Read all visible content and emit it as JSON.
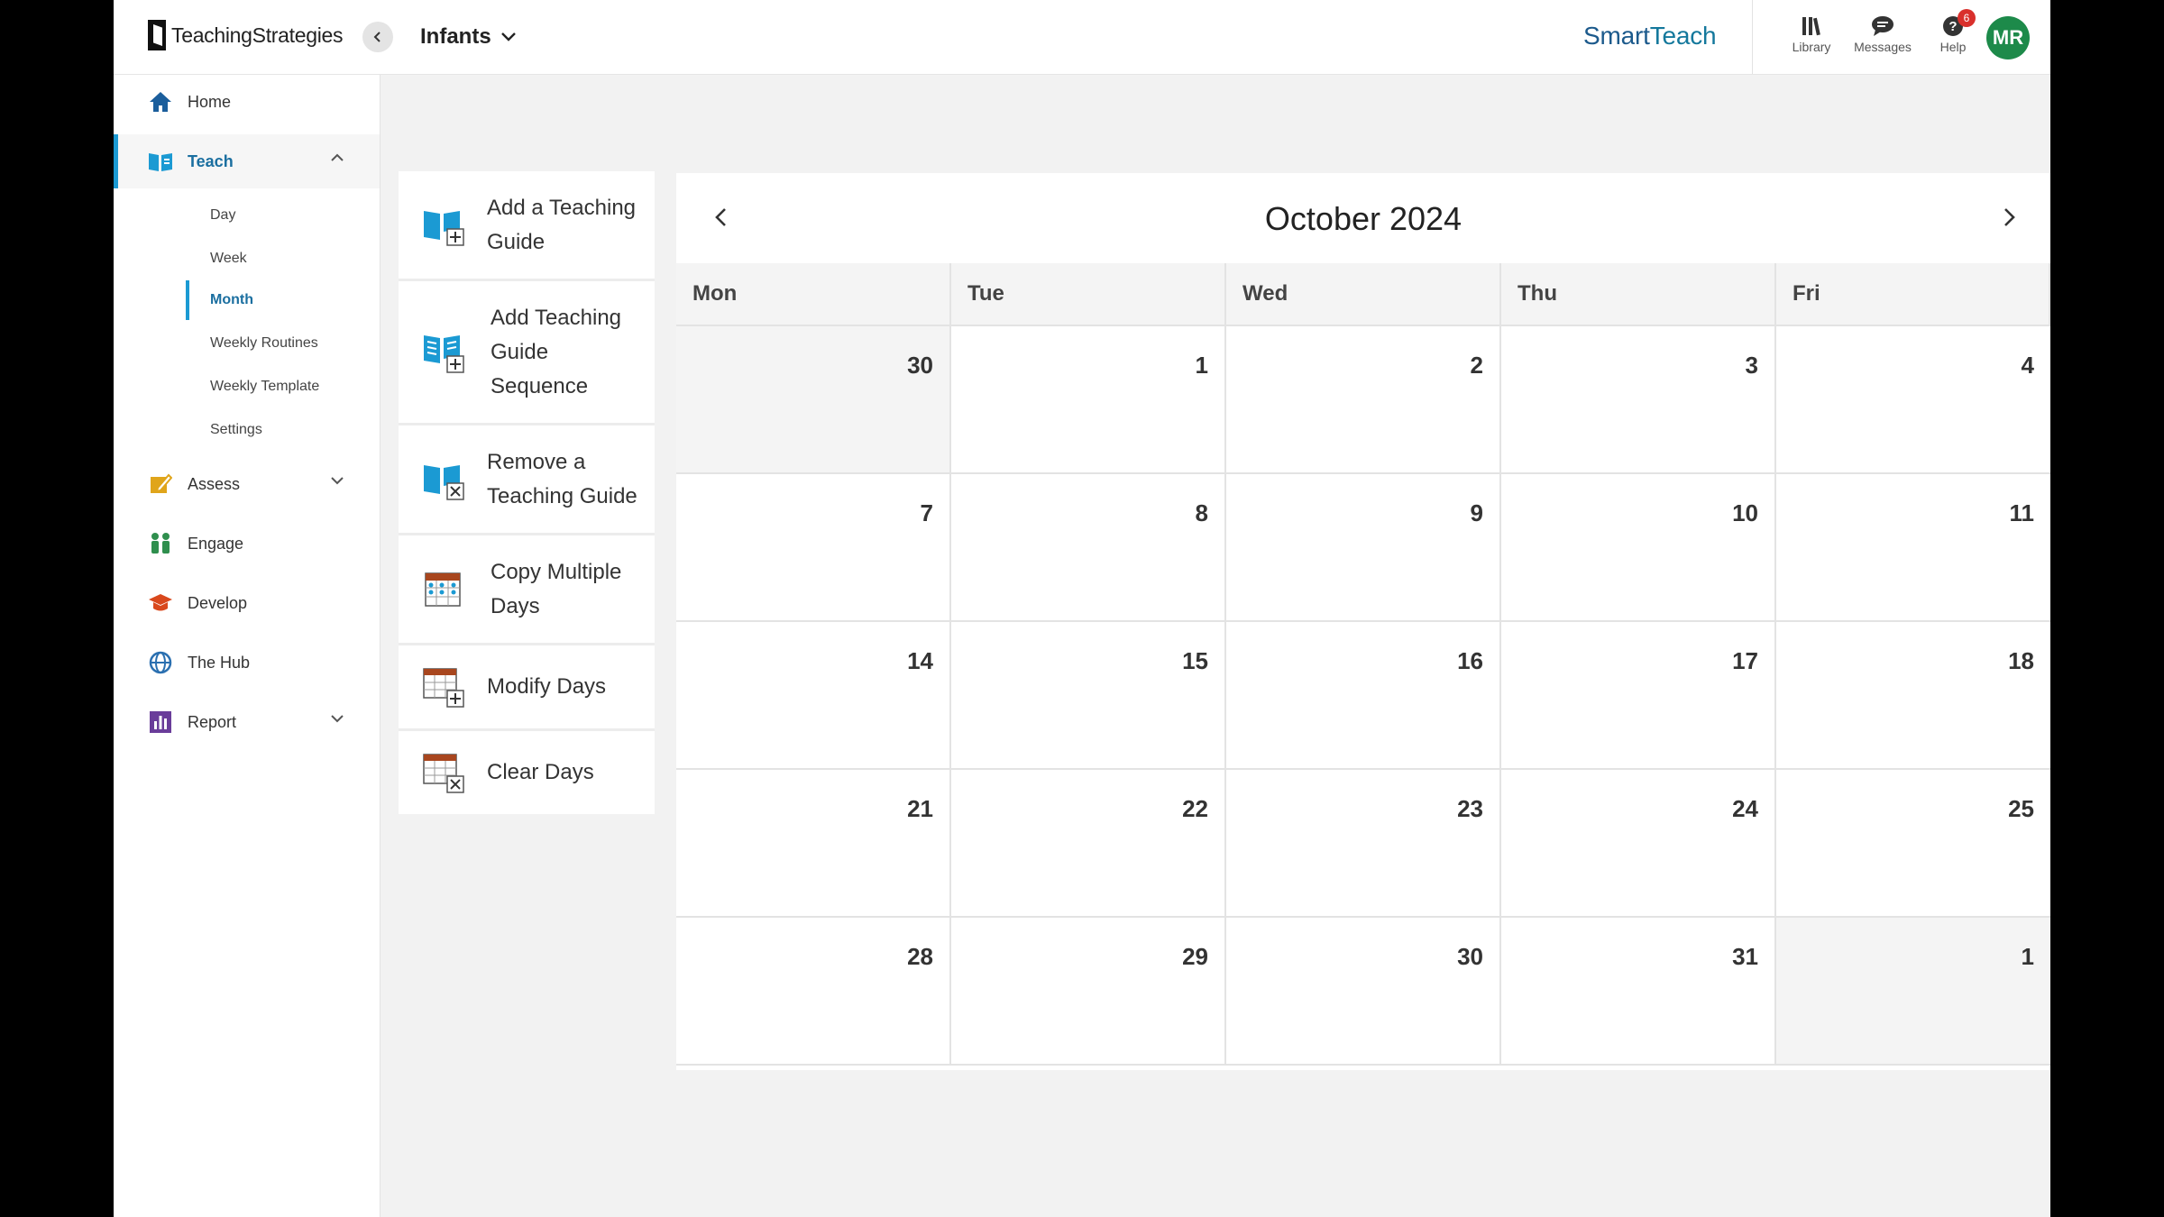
{
  "header": {
    "logo_text": "TeachingStrategies",
    "class_name": "Infants",
    "brand": "SmartTeach",
    "brand_parts": [
      "Smart",
      "Teach"
    ],
    "icons": [
      {
        "label": "Library",
        "icon": "library-icon"
      },
      {
        "label": "Messages",
        "icon": "messages-icon"
      },
      {
        "label": "Help",
        "icon": "help-icon",
        "badge": "6"
      }
    ],
    "avatar_initials": "MR"
  },
  "sidebar": {
    "items": [
      {
        "label": "Home",
        "icon": "home-icon",
        "color": "#1b5e9c"
      },
      {
        "label": "Teach",
        "icon": "book-icon",
        "color": "#1b9ad3",
        "expanded": true
      },
      {
        "label": "Assess",
        "icon": "assess-icon",
        "color": "#e0a51b"
      },
      {
        "label": "Engage",
        "icon": "engage-icon",
        "color": "#2f8f4e"
      },
      {
        "label": "Develop",
        "icon": "graduation-cap-icon",
        "color": "#d9481c"
      },
      {
        "label": "The Hub",
        "icon": "globe-icon",
        "color": "#2a6fb0"
      },
      {
        "label": "Report",
        "icon": "report-icon",
        "color": "#6a3d9a"
      }
    ],
    "teach_sub_items": [
      "Day",
      "Week",
      "Month",
      "Weekly Routines",
      "Weekly Template",
      "Settings"
    ],
    "active_sub_item": "Month"
  },
  "actions": [
    {
      "label": "Add a Teaching Guide",
      "lines": [
        "Add a Teaching",
        "Guide"
      ],
      "icon": "add-guide-icon"
    },
    {
      "label": "Add Teaching Guide Sequence",
      "lines": [
        "Add Teaching",
        "Guide",
        "Sequence"
      ],
      "icon": "add-sequence-icon"
    },
    {
      "label": "Remove a Teaching Guide",
      "lines": [
        "Remove a",
        "Teaching Guide"
      ],
      "icon": "remove-guide-icon"
    },
    {
      "label": "Copy Multiple Days",
      "lines": [
        "Copy Multiple",
        "Days"
      ],
      "icon": "copy-days-icon"
    },
    {
      "label": "Modify Days",
      "lines": [
        "Modify Days"
      ],
      "icon": "modify-days-icon"
    },
    {
      "label": "Clear Days",
      "lines": [
        "Clear Days"
      ],
      "icon": "clear-days-icon"
    }
  ],
  "calendar": {
    "title": "October 2024",
    "weekdays": [
      "Mon",
      "Tue",
      "Wed",
      "Thu",
      "Fri"
    ],
    "weeks": [
      [
        "30",
        "1",
        "2",
        "3",
        "4"
      ],
      [
        "7",
        "8",
        "9",
        "10",
        "11"
      ],
      [
        "14",
        "15",
        "16",
        "17",
        "18"
      ],
      [
        "21",
        "22",
        "23",
        "24",
        "25"
      ],
      [
        "28",
        "29",
        "30",
        "31",
        "1"
      ]
    ],
    "outside_month": [
      [
        0,
        0
      ],
      [
        4,
        4
      ]
    ]
  },
  "colors": {
    "accent": "#1b9ad3",
    "brand_blue": "#1c5a8c",
    "avatar_green": "#1d8a4a",
    "badge_red": "#d9302c"
  }
}
